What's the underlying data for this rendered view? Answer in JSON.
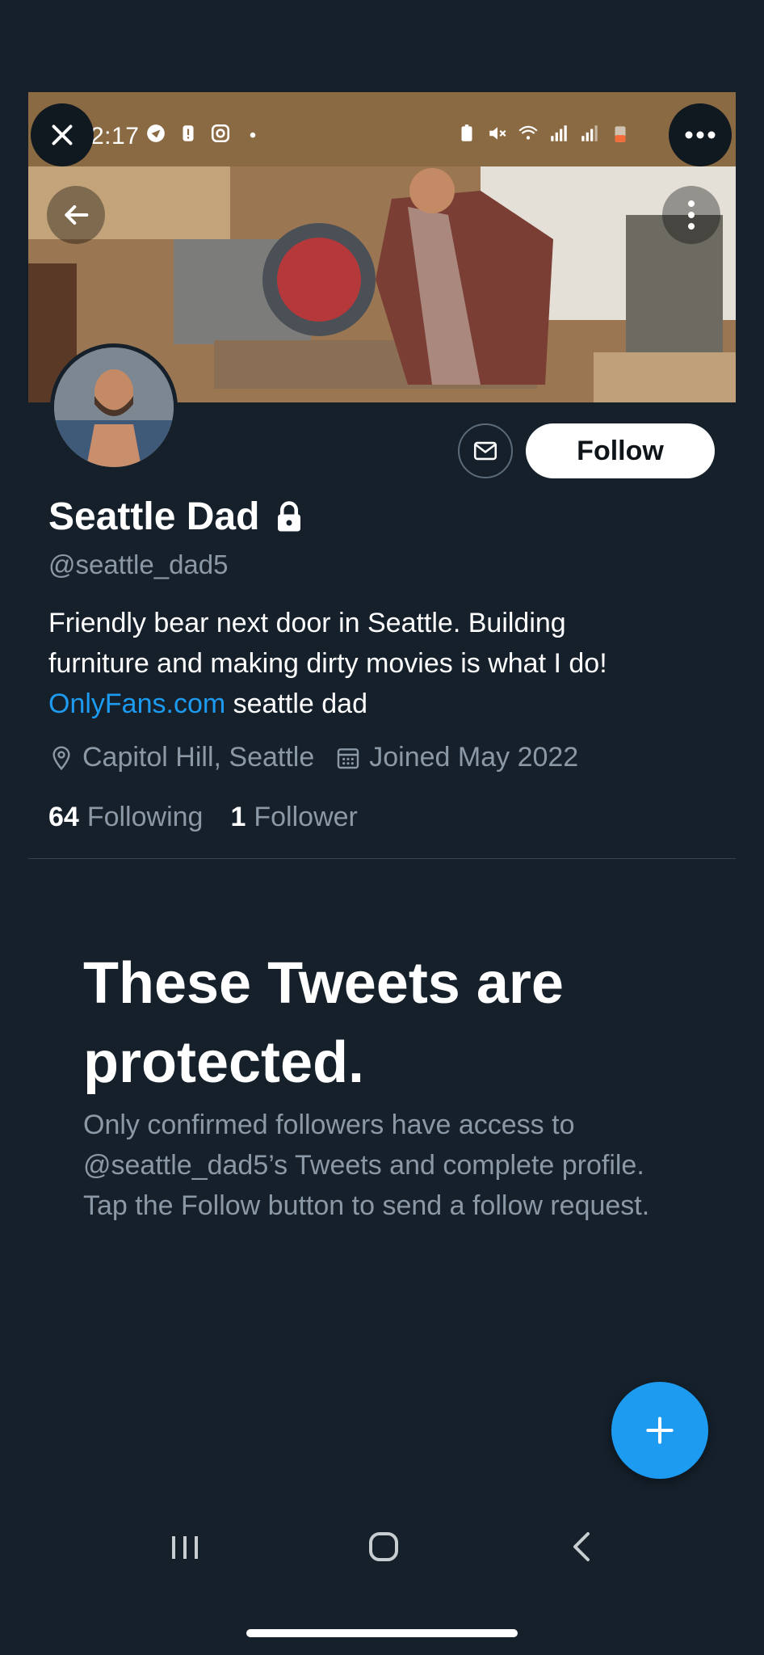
{
  "status_bar": {
    "time": "2:17"
  },
  "overlay": {
    "close_icon": "close-icon",
    "more_icon": "more-horizontal-icon"
  },
  "header": {
    "back_icon": "arrow-left-icon",
    "menu_icon": "more-vertical-icon"
  },
  "profile": {
    "name": "Seattle Dad",
    "lock_icon": "lock-icon",
    "handle": "@seattle_dad5",
    "bio_line1": "Friendly bear next door in Seattle. Building",
    "bio_line2": "furniture and making dirty movies is what I do!",
    "bio_link": "OnlyFans.com",
    "bio_tail": " seattle dad",
    "location": "Capitol Hill, Seattle",
    "joined": "Joined May 2022",
    "following_count": "64",
    "following_label": "Following",
    "followers_count": "1",
    "followers_label": "Follower",
    "follow_button": "Follow"
  },
  "protected": {
    "title": "These Tweets are protected.",
    "body": "Only confirmed followers have access to @seattle_dad5’s Tweets and complete profile. Tap the Follow button to send a follow request."
  },
  "colors": {
    "background": "#15202b",
    "accent": "#1d9bf0",
    "muted_text": "#8b98a5"
  }
}
